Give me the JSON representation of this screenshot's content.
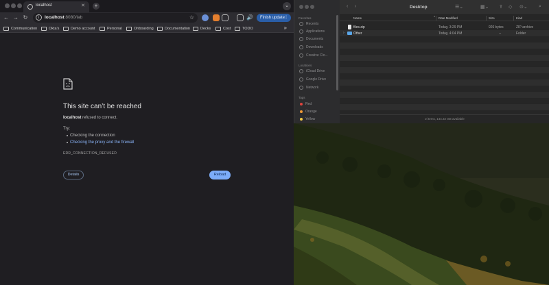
{
  "browser": {
    "tab_title": "localhost",
    "url_host": "localhost",
    "url_rest": ":8080/lab",
    "finish_update_label": "Finish update",
    "bookmarks": [
      "Communication",
      "Okta's",
      "Demo account",
      "Personal",
      "Onboarding",
      "Documentation",
      "Decks",
      "Cost",
      "TODO"
    ],
    "error": {
      "title": "This site can’t be reached",
      "host": "localhost",
      "message": " refused to connect.",
      "try_label": "Try:",
      "suggestions": [
        "Checking the connection",
        "Checking the proxy and the firewall"
      ],
      "code": "ERR_CONNECTION_REFUSED",
      "details_label": "Details",
      "reload_label": "Reload"
    }
  },
  "finder": {
    "title": "Desktop",
    "sidebar": {
      "favorites_label": "Favorites",
      "favorites": [
        "Recents",
        "Applications",
        "Documents",
        "Downloads",
        "Creative Clo..."
      ],
      "locations_label": "Locations",
      "locations": [
        "iCloud Drive",
        "Google Drive",
        "Network"
      ],
      "tags_label": "Tags",
      "tags": [
        {
          "name": "Red",
          "color": "#e0443e"
        },
        {
          "name": "Orange",
          "color": "#f09a37"
        },
        {
          "name": "Yellow",
          "color": "#f5cc47"
        }
      ]
    },
    "columns": {
      "name": "Name",
      "date": "Date Modified",
      "size": "Size",
      "kind": "Kind"
    },
    "rows": [
      {
        "name": "files.zip",
        "date": "Today, 3:29 PM",
        "size": "926 bytes",
        "kind": "ZIP archive"
      },
      {
        "name": "Other",
        "date": "Today, 4:04 PM",
        "size": "--",
        "kind": "Folder"
      }
    ],
    "status": "2 items, 144.32 GB available"
  }
}
